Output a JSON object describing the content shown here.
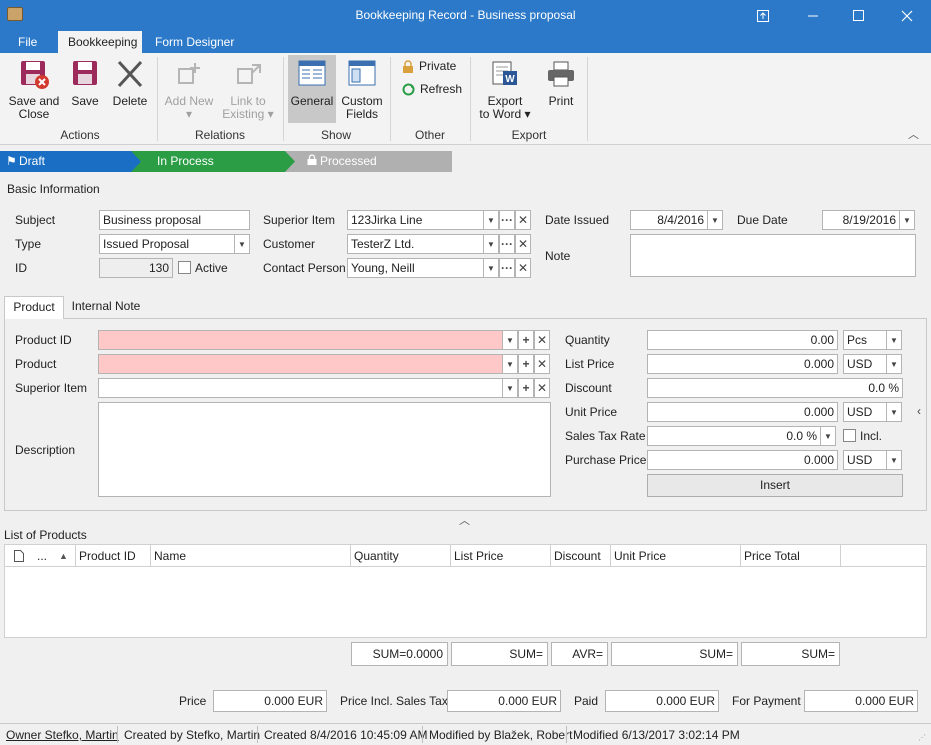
{
  "window": {
    "title": "Bookkeeping Record - Business proposal",
    "controls": [
      "restore-down-icon",
      "minimize-icon",
      "maximize-icon",
      "close-icon"
    ]
  },
  "menu": {
    "tabs": [
      "File",
      "Bookkeeping",
      "Form Designer"
    ],
    "active_tab": "Bookkeeping"
  },
  "ribbon": {
    "groups": {
      "actions": "Actions",
      "relations": "Relations",
      "show": "Show",
      "other": "Other",
      "export": "Export"
    },
    "buttons": {
      "save_close_l1": "Save and",
      "save_close_l2": "Close",
      "save": "Save",
      "delete": "Delete",
      "add_new_l1": "Add New",
      "link_existing_l1": "Link to",
      "link_existing_l2": "Existing",
      "general": "General",
      "custom_fields_l1": "Custom",
      "custom_fields_l2": "Fields",
      "private": "Private",
      "refresh": "Refresh",
      "export_word_l1": "Export",
      "export_word_l2": "to Word",
      "print": "Print"
    }
  },
  "workflow": {
    "steps": [
      "Draft",
      "In Process",
      "Processed"
    ],
    "colors": {
      "draft": "#1a6fc4",
      "in_process": "#2a9d45",
      "processed": "#b0b0b0"
    }
  },
  "basic": {
    "section_title": "Basic Information",
    "subject_label": "Subject",
    "subject_value": "Business proposal",
    "type_label": "Type",
    "type_value": "Issued Proposal",
    "id_label": "ID",
    "id_value": "130",
    "active_label": "Active",
    "superior_item_label": "Superior Item",
    "superior_item_value": "123Jirka Line",
    "customer_label": "Customer",
    "customer_value": "TesterZ Ltd.",
    "contact_label": "Contact Person",
    "contact_value": "Young, Neill",
    "date_issued_label": "Date Issued",
    "date_issued_value": "8/4/2016",
    "due_date_label": "Due Date",
    "due_date_value": "8/19/2016",
    "note_label": "Note",
    "note_value": ""
  },
  "product_tabs": [
    "Product",
    "Internal Note"
  ],
  "product": {
    "product_id_label": "Product ID",
    "product_label": "Product",
    "superior_item_label": "Superior Item",
    "description_label": "Description",
    "quantity_label": "Quantity",
    "quantity_value": "0.00",
    "quantity_unit": "Pcs",
    "list_price_label": "List Price",
    "list_price_value": "0.000",
    "list_price_currency": "USD",
    "discount_label": "Discount",
    "discount_value": "0.0 %",
    "unit_price_label": "Unit Price",
    "unit_price_value": "0.000",
    "unit_price_currency": "USD",
    "sales_tax_label": "Sales Tax Rate",
    "sales_tax_value": "0.0 %",
    "incl_label": "Incl.",
    "purchase_price_label": "Purchase Price",
    "purchase_price_value": "0.000",
    "purchase_price_currency": "USD",
    "insert_label": "Insert"
  },
  "list": {
    "title": "List of Products",
    "ellipsis": "...",
    "columns": [
      "Product ID",
      "Name",
      "Quantity",
      "List Price",
      "Discount",
      "Unit Price",
      "Price Total"
    ],
    "sums": [
      "SUM=0.0000",
      "SUM=",
      "AVR=",
      "SUM=",
      "SUM="
    ]
  },
  "totals": {
    "price_label": "Price",
    "price_value": "0.000 EUR",
    "price_incl_label": "Price Incl. Sales Tax",
    "price_incl_value": "0.000 EUR",
    "paid_label": "Paid",
    "paid_value": "0.000 EUR",
    "for_payment_label": "For Payment",
    "for_payment_value": "0.000 EUR"
  },
  "status": {
    "owner": "Owner Stefko, Martin",
    "created_by": "Created by Stefko, Martin",
    "created": "Created 8/4/2016 10:45:09 AM",
    "modified_by": "Modified by Blažek, Robert",
    "modified": "Modified 6/13/2017 3:02:14 PM"
  }
}
